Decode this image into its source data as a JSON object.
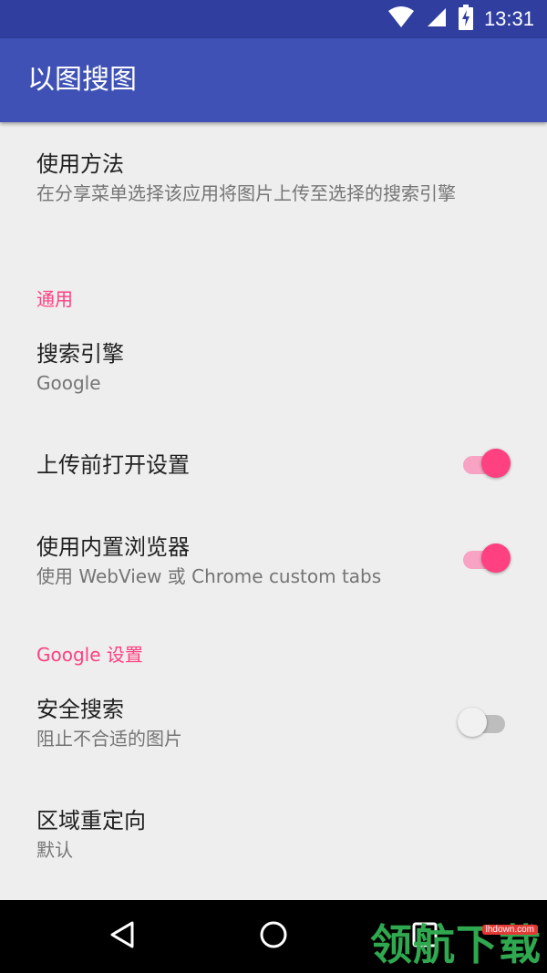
{
  "status_bar": {
    "time": "13:31"
  },
  "app_bar": {
    "title": "以图搜图"
  },
  "prefs": {
    "usage": {
      "title": "使用方法",
      "summary": "在分享菜单选择该应用将图片上传至选择的搜索引擎"
    },
    "category_general": "通用",
    "search_engine": {
      "title": "搜索引擎",
      "summary": "Google"
    },
    "open_settings": {
      "title": "上传前打开设置",
      "checked": true
    },
    "builtin_browser": {
      "title": "使用内置浏览器",
      "summary": "使用 WebView 或 Chrome custom tabs",
      "checked": true
    },
    "category_google": "Google 设置",
    "safe_search": {
      "title": "安全搜索",
      "summary": "阻止不合适的图片",
      "checked": false
    },
    "region_redirect": {
      "title": "区域重定向",
      "summary": "默认"
    }
  },
  "watermark": {
    "text": "领航下载",
    "tag": "lhdown.com"
  },
  "colors": {
    "primary": "#3f51b5",
    "primary_dark": "#303f9f",
    "accent": "#ff4081"
  }
}
